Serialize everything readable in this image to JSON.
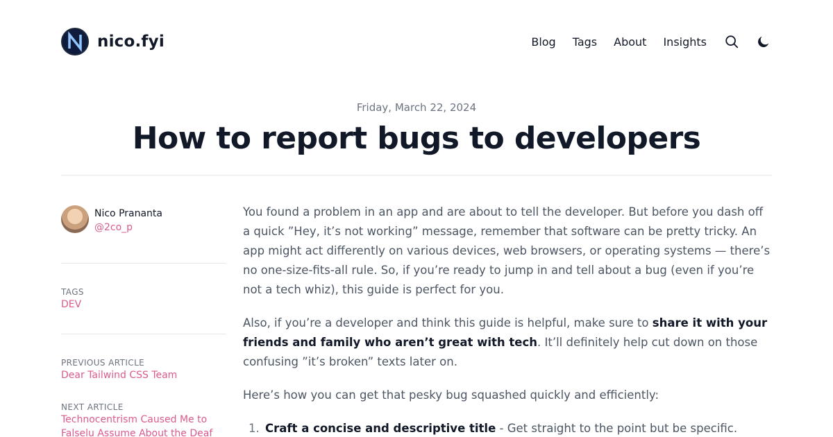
{
  "header": {
    "site_name": "nico.fyi",
    "logo_letter": "N",
    "nav": [
      "Blog",
      "Tags",
      "About",
      "Insights"
    ],
    "search_icon": "search-icon",
    "theme_icon": "moon-icon"
  },
  "post": {
    "date": "Friday, March 22, 2024",
    "title": "How to report bugs to developers"
  },
  "sidebar": {
    "author_name": "Nico Prananta",
    "author_handle": "@2co_p",
    "tags_label": "TAGS",
    "tag": "DEV",
    "prev_label": "PREVIOUS ARTICLE",
    "prev_title": "Dear Tailwind CSS Team",
    "next_label": "NEXT ARTICLE",
    "next_title": "Technocentrism Caused Me to Falselu Assume About the Deaf"
  },
  "article": {
    "p1": "You found a problem in an app and are about to tell the developer. But before you dash off a quick ”Hey, it’s not working” message, remember that software can be pretty tricky. An app might act differently on various devices, web browsers, or operating systems — there’s no one-size-fits-all rule. So, if you’re ready to jump in and tell about a bug (even if you’re not a tech whiz), this guide is perfect for you.",
    "p2_start": "Also, if you’re a developer and think this guide is helpful, make sure to ",
    "p2_bold": "share it with your friends and family who aren’t great with tech",
    "p2_end": ". It’ll definitely help cut down on those confusing ”it’s broken” texts later on.",
    "p3": "Here’s how you can get that pesky bug squashed quickly and efficiently:",
    "li1_num": "1.",
    "li1_bold": "Craft a concise and descriptive title",
    "li1_text": " - Get straight to the point but be specific. ”Upload"
  },
  "colors": {
    "accent": "#db5a8e",
    "text": "#111827",
    "muted": "#6b7280",
    "rule": "#e5e7eb"
  }
}
